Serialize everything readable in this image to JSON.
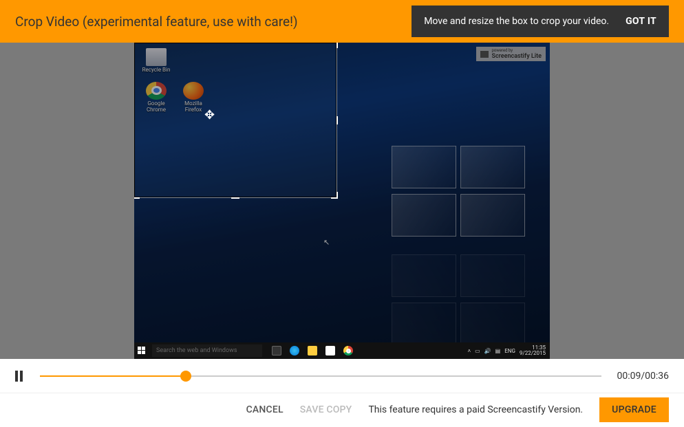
{
  "banner": {
    "title": "Crop Video (experimental feature, use with care!)",
    "tooltip_text": "Move and resize the box to crop your video.",
    "tooltip_button": "GOT IT"
  },
  "watermark": {
    "line1": "powered by",
    "line2": "Screencastify Lite"
  },
  "desktop": {
    "icons": [
      {
        "name": "recycle-bin",
        "label": "Recycle Bin"
      },
      {
        "name": "google-chrome",
        "label": "Google Chrome"
      },
      {
        "name": "mozilla-firefox",
        "label": "Mozilla Firefox"
      }
    ],
    "search_placeholder": "Search the web and Windows",
    "tray": {
      "lang": "ENG",
      "time": "11:35",
      "date": "9/22/2015"
    }
  },
  "player": {
    "current": "00:09",
    "total": "00:36",
    "progress_pct": 26
  },
  "footer": {
    "cancel": "CANCEL",
    "save": "SAVE COPY",
    "message": "This feature requires a paid Screencastify Version.",
    "upgrade": "UPGRADE"
  }
}
